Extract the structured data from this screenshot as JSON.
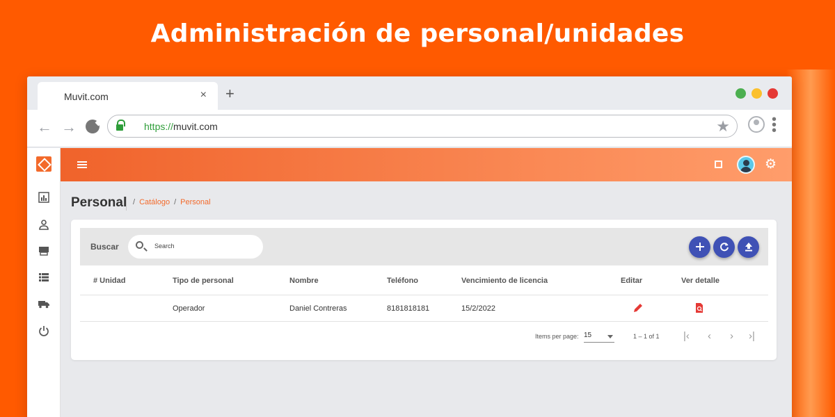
{
  "headline": "Administración de personal/unidades",
  "browser": {
    "tab_title": "Muvit.com",
    "tab_close": "×",
    "new_tab": "+",
    "url_scheme": "https://",
    "url_host": "muvit.com",
    "window_dots": [
      "#4caf50",
      "#fbc02d",
      "#e53935"
    ]
  },
  "page": {
    "title": "Personal",
    "breadcrumb": [
      "Catálogo",
      "Personal"
    ],
    "breadcrumb_separator": "/"
  },
  "search": {
    "label": "Buscar",
    "placeholder": "Search"
  },
  "actions": [
    "add",
    "refresh",
    "upload"
  ],
  "table": {
    "columns": [
      "# Unidad",
      "Tipo de personal",
      "Nombre",
      "Teléfono",
      "Vencimiento de licencia",
      "Editar",
      "Ver detalle"
    ],
    "rows": [
      {
        "unidad": "",
        "tipo": "Operador",
        "nombre": "Daniel Contreras",
        "telefono": "8181818181",
        "vencimiento": "15/2/2022"
      }
    ]
  },
  "paginator": {
    "items_per_page_label": "Items per page:",
    "items_per_page": "15",
    "range": "1 – 1 of 1"
  },
  "colors": {
    "brand_orange": "#ff5a00",
    "accent": "#f36a2b",
    "fab_blue": "#3f51b5",
    "icon_red": "#e53935"
  }
}
